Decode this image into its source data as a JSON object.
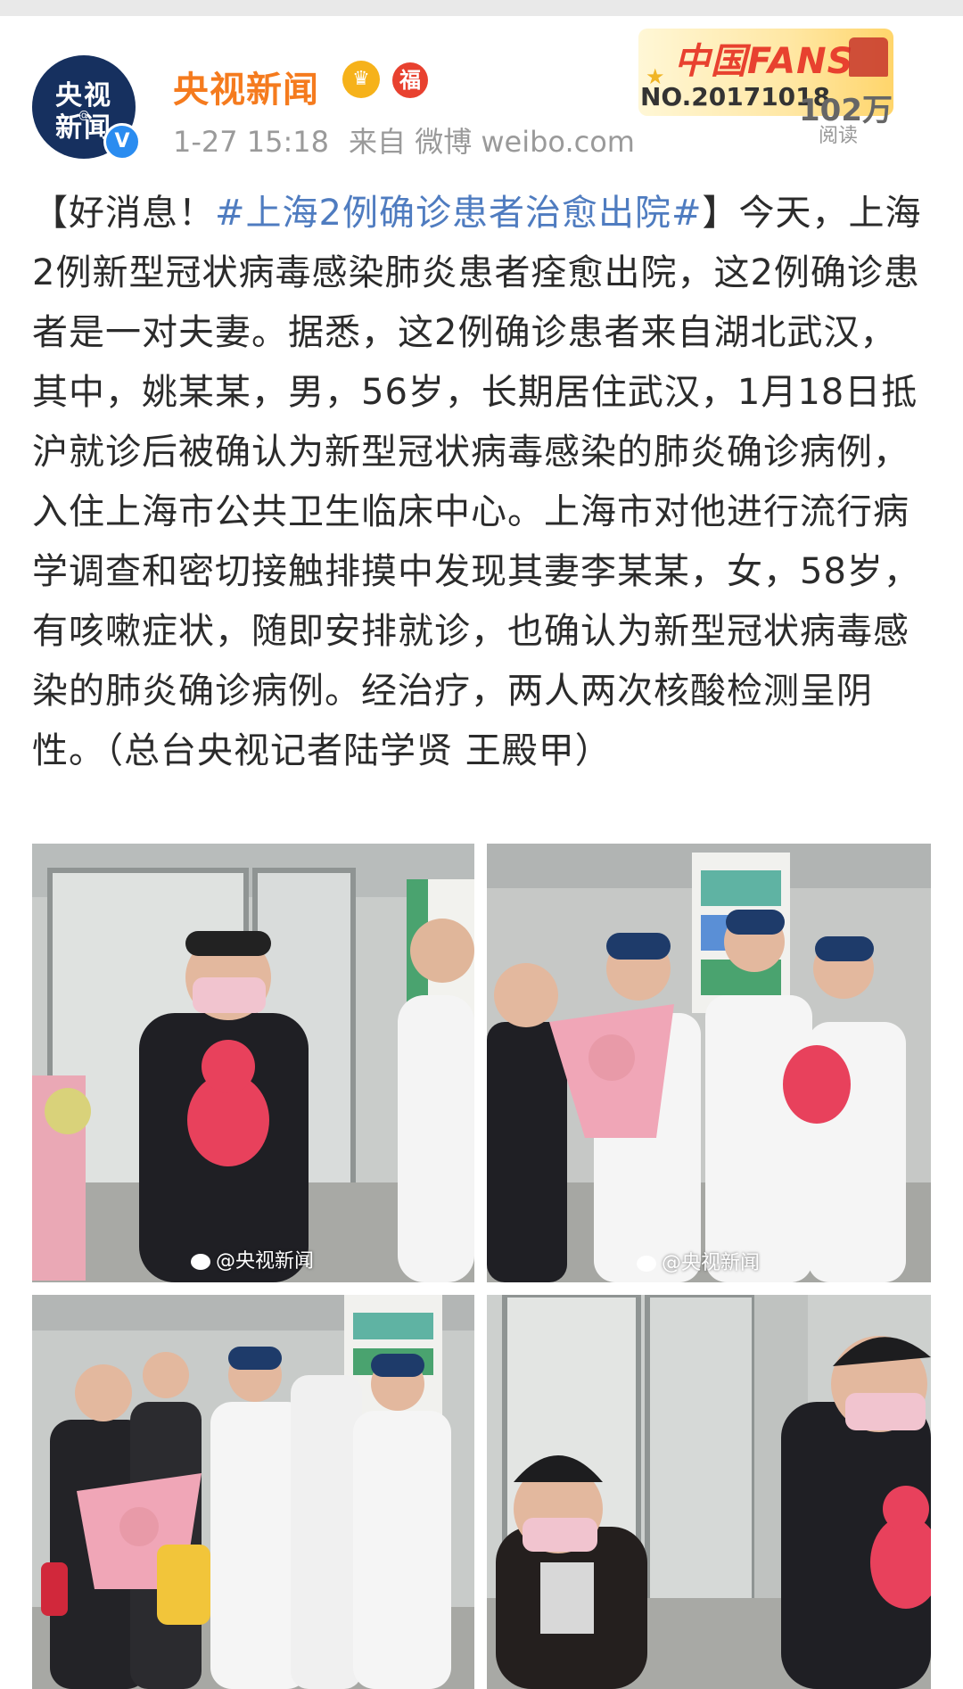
{
  "header": {
    "avatar": {
      "line1": "央视",
      "line2": "新闻",
      "at_mark": "@"
    },
    "verified_mark": "V",
    "username": "央视新闻",
    "badges": [
      "crown-icon",
      "fu-badge-icon"
    ],
    "fu_text": "福",
    "time": "1-27 15:18",
    "source": "来自 微博 weibo.com",
    "fans_banner": {
      "brand": "中国FANS",
      "number": "NO.20171018"
    },
    "reads": "102万",
    "reads_label": "阅读"
  },
  "post": {
    "prefix": "【好消息！",
    "hashtag": "#上海2例确诊患者治愈出院#",
    "suffix": "】今天，上海2例新型冠状病毒感染肺炎患者痊愈出院，这2例确诊患者是一对夫妻。据悉，这2例确诊患者来自湖北武汉，其中，姚某某，男，56岁，长期居住武汉，1月18日抵沪就诊后被确认为新型冠状病毒感染的肺炎确诊病例，入住上海市公共卫生临床中心。上海市对他进行流行病学调查和密切接触排摸中发现其妻李某某，女，58岁，有咳嗽症状，随即安排就诊，也确认为新型冠状病毒感染的肺炎确诊病例。经治疗，两人两次核酸检测呈阴性。（总台央视记者陆学贤 王殿甲）"
  },
  "photos": {
    "watermark": "@央视新闻",
    "items": [
      {
        "name": "photo-man-with-plush-toy",
        "watermark": true
      },
      {
        "name": "photo-woman-receives-flowers",
        "watermark": true
      },
      {
        "name": "photo-couple-with-medical-staff",
        "watermark": false
      },
      {
        "name": "photo-couple-leaving",
        "watermark": false
      }
    ]
  },
  "colors": {
    "username": "#f57b1e",
    "hashtag": "#4f7cc0",
    "meta": "#9a9a9a",
    "avatar_bg": "#16305f"
  }
}
